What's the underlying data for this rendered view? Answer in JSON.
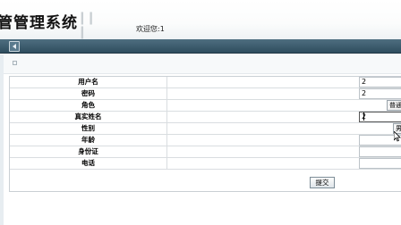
{
  "header": {
    "app_title": "管管理系统",
    "welcome_text": "欢迎您:1"
  },
  "form": {
    "rows": [
      {
        "label": "用户名",
        "value": "2",
        "type": "text"
      },
      {
        "label": "密码",
        "value": "2",
        "type": "password"
      },
      {
        "label": "角色",
        "value": "普通管",
        "type": "select"
      },
      {
        "label": "真实姓名",
        "value": "2",
        "type": "text"
      },
      {
        "label": "性别",
        "value": "男",
        "type": "select"
      },
      {
        "label": "年龄",
        "value": "",
        "type": "text"
      },
      {
        "label": "身份证",
        "value": "",
        "type": "text"
      },
      {
        "label": "电话",
        "value": "",
        "type": "text"
      }
    ],
    "submit_label": "提交"
  },
  "icons": {
    "collapse": "collapse-left-icon",
    "breadcrumb": "breadcrumb-icon",
    "cursor": "mouse-pointer-icon"
  },
  "colors": {
    "toolbar": "#3f5e70",
    "border": "#c9cfd4"
  }
}
